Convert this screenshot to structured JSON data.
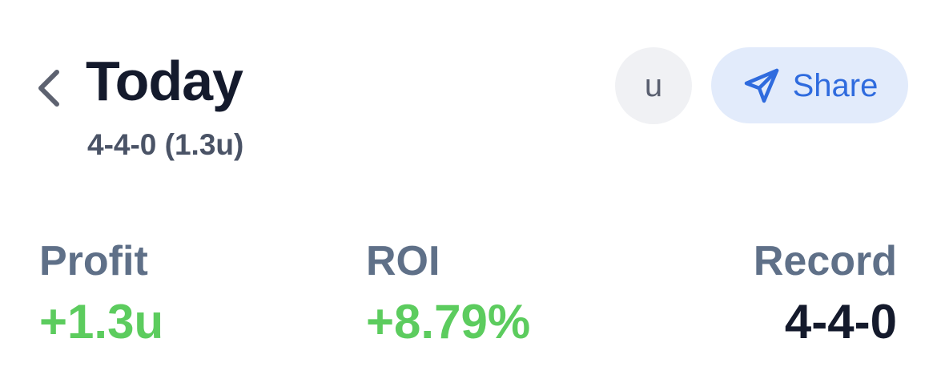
{
  "header": {
    "title": "Today",
    "subtitle": "4-4-0 (1.3u)",
    "back_icon": "chevron-left-icon",
    "unit_button_label": "u",
    "share_button": {
      "label": "Share",
      "icon": "paper-plane-icon"
    }
  },
  "stats": {
    "profit": {
      "label": "Profit",
      "value": "+1.3u"
    },
    "roi": {
      "label": "ROI",
      "value": "+8.79%"
    },
    "record": {
      "label": "Record",
      "value": "4-4-0"
    }
  },
  "colors": {
    "title": "#141a2c",
    "label": "#5f7088",
    "positive": "#5ccc5e",
    "share_bg": "#e2ebfb",
    "share_text": "#2f6bde",
    "unit_bg": "#f0f1f4"
  }
}
